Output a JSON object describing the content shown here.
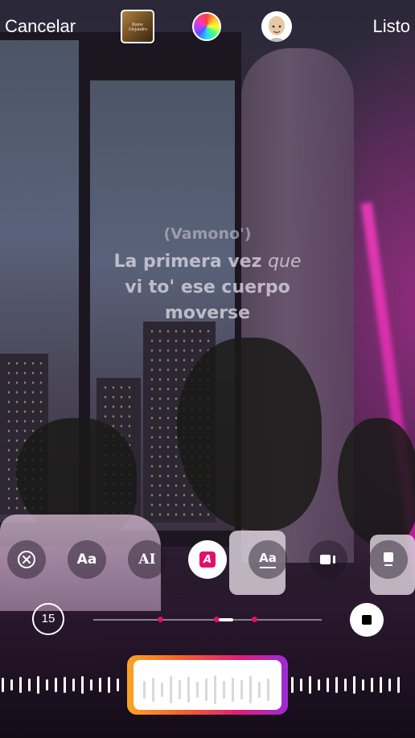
{
  "header": {
    "cancel_label": "Cancelar",
    "done_label": "Listo",
    "album_caption": "Rauw Alejandro"
  },
  "icons": {
    "album": "album-art-icon",
    "color": "color-wheel-icon",
    "avatar": "memoji-avatar-icon",
    "remove": "close-circle-icon",
    "style_1": "text-style-aa-icon",
    "style_2": "text-style-ai-icon",
    "style_3": "text-style-a-box-icon",
    "style_4": "text-style-aa-underline-icon",
    "style_5": "video-card-icon",
    "style_6": "sticker-card-icon",
    "stop": "stop-icon"
  },
  "colors": {
    "accent_pink": "#e0106c",
    "gradient_start": "#f8a524",
    "gradient_end": "#9b2bd6"
  },
  "lyrics": {
    "line1": "(Vamono')",
    "line2a": "La primera vez ",
    "line2b": "que",
    "line3": "vi to' ese cuerpo",
    "line4": "moverse"
  },
  "toolbar": {
    "aa": "Aa",
    "ai": "AI",
    "a_box": "A",
    "aa_underline": "Aa"
  },
  "timeline": {
    "duration": "15"
  }
}
